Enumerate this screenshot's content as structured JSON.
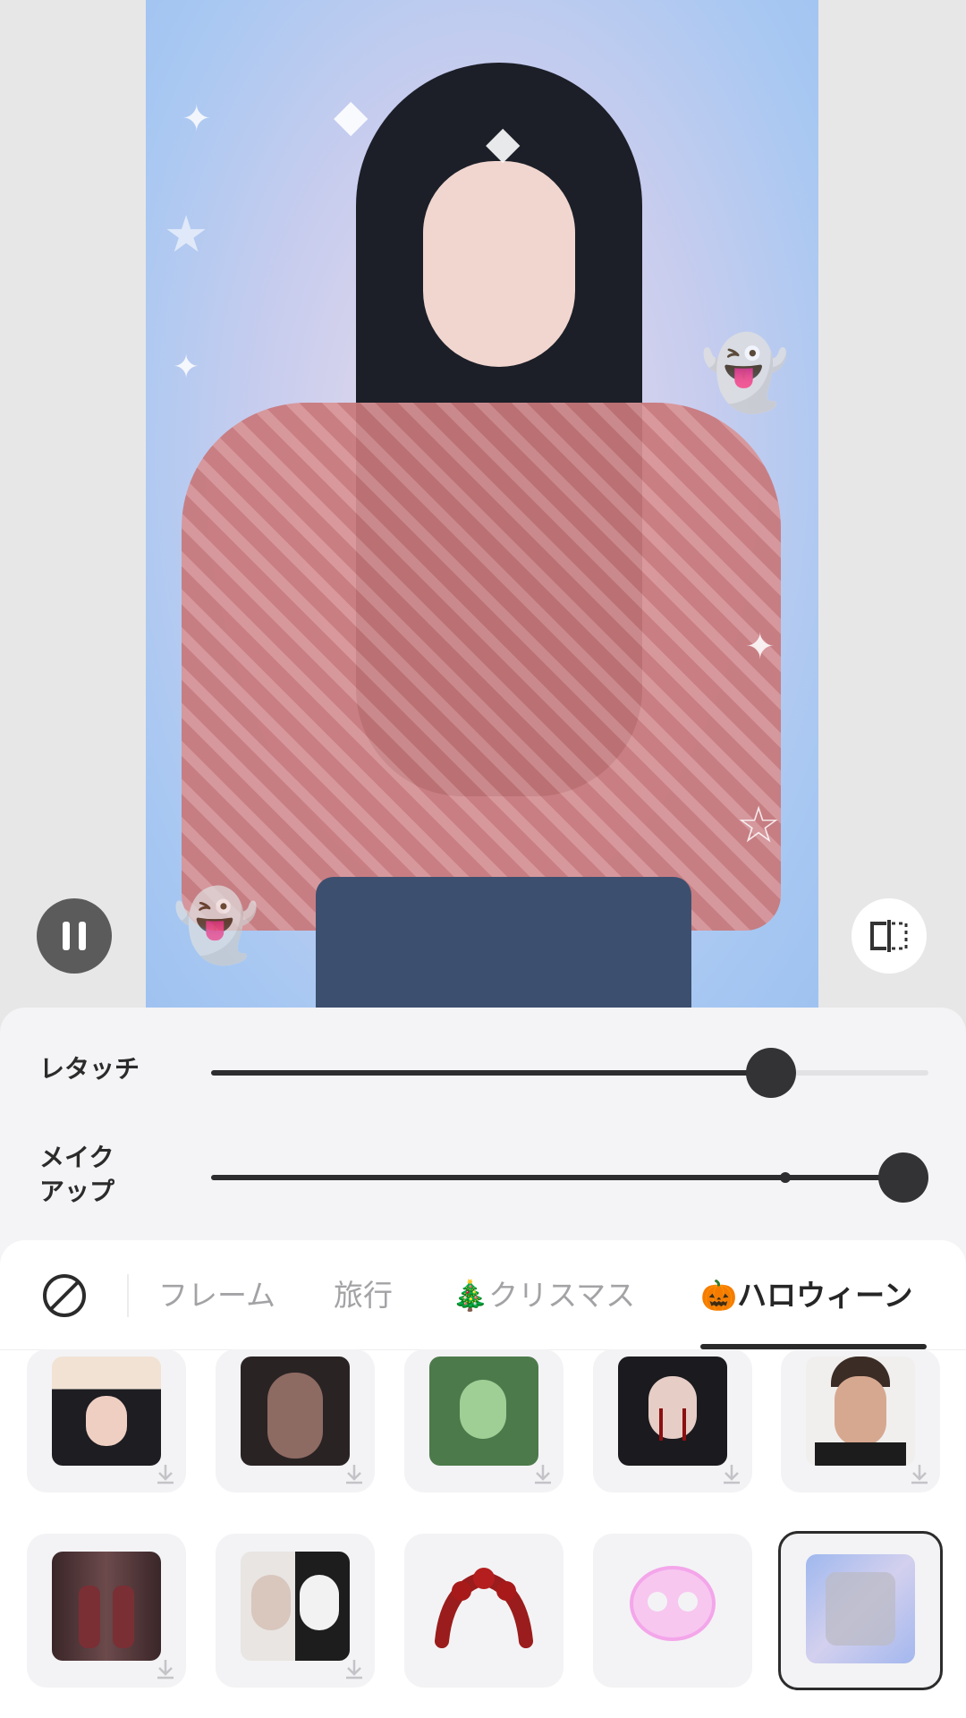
{
  "preview": {
    "pause_icon": "pause-icon",
    "compare_icon": "compare-split-icon"
  },
  "adjustments": {
    "sliders": [
      {
        "label": "レタッチ",
        "value": 0.78
      },
      {
        "label": "メイク\nアップ",
        "value": 1.0,
        "default_marker": 0.8
      }
    ]
  },
  "filters": {
    "none_icon": "no-filter-icon",
    "tabs": [
      {
        "label": "フレーム",
        "active": false
      },
      {
        "label": "旅行",
        "active": false
      },
      {
        "label": "🎄クリスマス",
        "active": false
      },
      {
        "label": "🎃ハロウィーン",
        "active": true
      }
    ],
    "items": [
      {
        "name": "bunny-ears-makeup",
        "downloaded": false,
        "selected": false
      },
      {
        "name": "zombie-face",
        "downloaded": false,
        "selected": false
      },
      {
        "name": "green-tint-portrait",
        "downloaded": false,
        "selected": false
      },
      {
        "name": "blood-tears-makeup",
        "downloaded": false,
        "selected": false
      },
      {
        "name": "bruised-face",
        "downloaded": false,
        "selected": false
      },
      {
        "name": "twins-hallway",
        "downloaded": false,
        "selected": false
      },
      {
        "name": "nun-skull-makeup",
        "downloaded": false,
        "selected": false
      },
      {
        "name": "red-rose-crown",
        "downloaded": true,
        "selected": false
      },
      {
        "name": "pink-skull-glow",
        "downloaded": true,
        "selected": false
      },
      {
        "name": "ghost-frame",
        "downloaded": true,
        "selected": true
      }
    ]
  }
}
